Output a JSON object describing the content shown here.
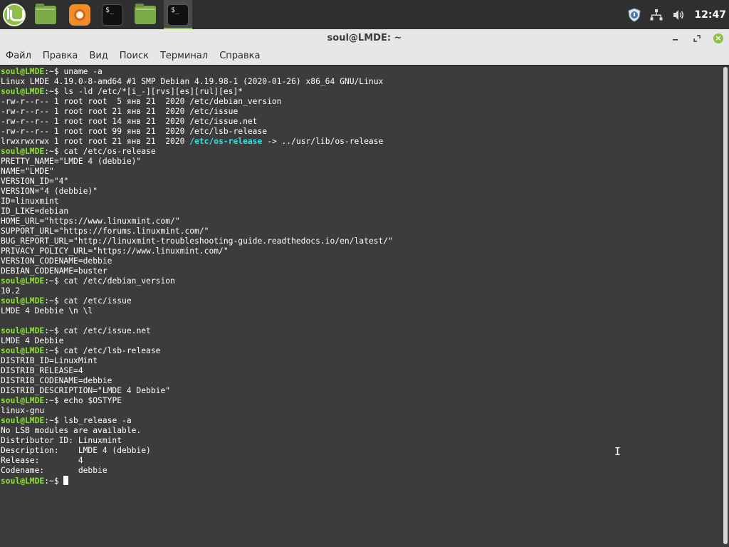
{
  "panel": {
    "launchers": [
      {
        "name": "Menu",
        "icon": "mint-menu-icon"
      },
      {
        "name": "Files",
        "icon": "folder-icon"
      },
      {
        "name": "Firefox",
        "icon": "firefox-icon"
      },
      {
        "name": "Terminal",
        "icon": "terminal-icon",
        "label": "$_"
      },
      {
        "name": "Files",
        "icon": "folder-icon"
      },
      {
        "name": "Terminal (active)",
        "icon": "terminal-icon",
        "label": "$_"
      }
    ],
    "tray": {
      "icons": [
        "shield-update-icon",
        "network-icon",
        "volume-icon"
      ],
      "clock": "12:47"
    }
  },
  "window": {
    "title": "soul@LMDE: ~",
    "controls": {
      "minimize": "minimize-icon",
      "maximize": "maximize-icon",
      "close": "close-icon"
    }
  },
  "menubar": [
    "Файл",
    "Правка",
    "Вид",
    "Поиск",
    "Терминал",
    "Справка"
  ],
  "terminal": {
    "prompt_user": "soul@LMDE",
    "prompt_tail": ":~$ ",
    "lines": [
      {
        "type": "prompt",
        "cmd": "uname -a"
      },
      {
        "type": "out",
        "text": "Linux LMDE 4.19.0-8-amd64 #1 SMP Debian 4.19.98-1 (2020-01-26) x86_64 GNU/Linux"
      },
      {
        "type": "prompt",
        "cmd": "ls -ld /etc/*[i_-][rvs][es][rul][es]*"
      },
      {
        "type": "out",
        "text": "-rw-r--r-- 1 root root  5 янв 21  2020 /etc/debian_version"
      },
      {
        "type": "out",
        "text": "-rw-r--r-- 1 root root 21 янв 21  2020 /etc/issue"
      },
      {
        "type": "out",
        "text": "-rw-r--r-- 1 root root 14 янв 21  2020 /etc/issue.net"
      },
      {
        "type": "out",
        "text": "-rw-r--r-- 1 root root 99 янв 21  2020 /etc/lsb-release"
      },
      {
        "type": "link",
        "pre": "lrwxrwxrwx 1 root root 21 янв 21  2020 ",
        "name": "/etc/os-release",
        "post": " -> ../usr/lib/os-release"
      },
      {
        "type": "prompt",
        "cmd": "cat /etc/os-release"
      },
      {
        "type": "out",
        "text": "PRETTY_NAME=\"LMDE 4 (debbie)\""
      },
      {
        "type": "out",
        "text": "NAME=\"LMDE\""
      },
      {
        "type": "out",
        "text": "VERSION_ID=\"4\""
      },
      {
        "type": "out",
        "text": "VERSION=\"4 (debbie)\""
      },
      {
        "type": "out",
        "text": "ID=linuxmint"
      },
      {
        "type": "out",
        "text": "ID_LIKE=debian"
      },
      {
        "type": "out",
        "text": "HOME_URL=\"https://www.linuxmint.com/\""
      },
      {
        "type": "out",
        "text": "SUPPORT_URL=\"https://forums.linuxmint.com/\""
      },
      {
        "type": "out",
        "text": "BUG_REPORT_URL=\"http://linuxmint-troubleshooting-guide.readthedocs.io/en/latest/\""
      },
      {
        "type": "out",
        "text": "PRIVACY_POLICY_URL=\"https://www.linuxmint.com/\""
      },
      {
        "type": "out",
        "text": "VERSION_CODENAME=debbie"
      },
      {
        "type": "out",
        "text": "DEBIAN_CODENAME=buster"
      },
      {
        "type": "prompt",
        "cmd": "cat /etc/debian_version"
      },
      {
        "type": "out",
        "text": "10.2"
      },
      {
        "type": "prompt",
        "cmd": "cat /etc/issue"
      },
      {
        "type": "out",
        "text": "LMDE 4 Debbie \\n \\l"
      },
      {
        "type": "out",
        "text": ""
      },
      {
        "type": "prompt",
        "cmd": "cat /etc/issue.net"
      },
      {
        "type": "out",
        "text": "LMDE 4 Debbie"
      },
      {
        "type": "prompt",
        "cmd": "cat /etc/lsb-release"
      },
      {
        "type": "out",
        "text": "DISTRIB_ID=LinuxMint"
      },
      {
        "type": "out",
        "text": "DISTRIB_RELEASE=4"
      },
      {
        "type": "out",
        "text": "DISTRIB_CODENAME=debbie"
      },
      {
        "type": "out",
        "text": "DISTRIB_DESCRIPTION=\"LMDE 4 Debbie\""
      },
      {
        "type": "prompt",
        "cmd": "echo $OSTYPE"
      },
      {
        "type": "out",
        "text": "linux-gnu"
      },
      {
        "type": "prompt",
        "cmd": "lsb_release -a"
      },
      {
        "type": "out",
        "text": "No LSB modules are available."
      },
      {
        "type": "out",
        "text": "Distributor ID:\tLinuxmint"
      },
      {
        "type": "out",
        "text": "Description:\tLMDE 4 (debbie)"
      },
      {
        "type": "out",
        "text": "Release:\t4"
      },
      {
        "type": "out",
        "text": "Codename:\tdebbie"
      },
      {
        "type": "prompt",
        "cmd": "",
        "cursor": true
      }
    ]
  },
  "colors": {
    "prompt_user": "#8ae234",
    "symlink": "#34e2e2",
    "background": "#3c3c3c",
    "accent": "#8fbf48"
  }
}
